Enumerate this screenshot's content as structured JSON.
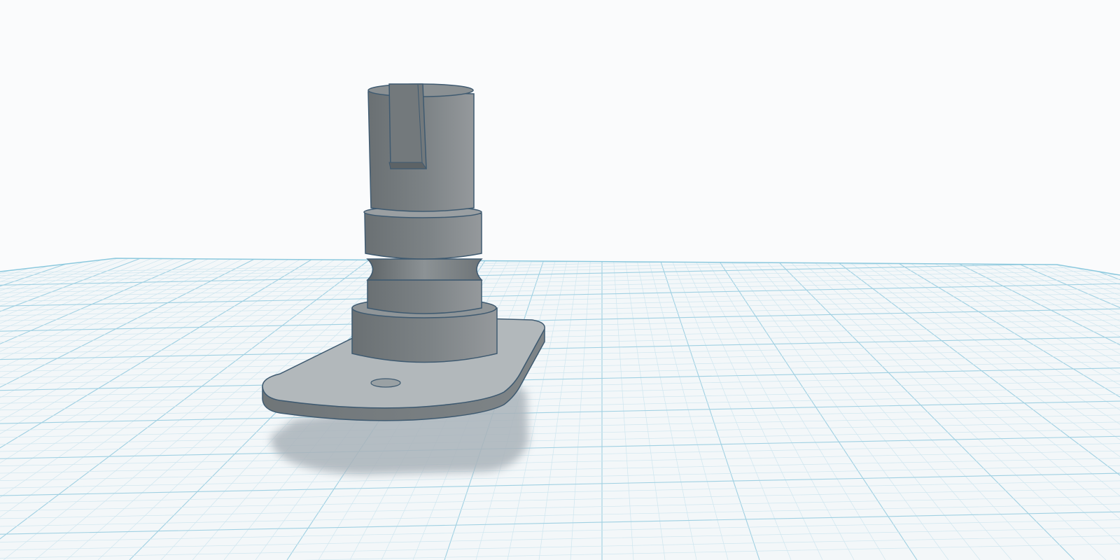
{
  "scene": {
    "type": "3d-design-workplane",
    "background_color": "#fafbfc",
    "workplane": {
      "fill_color": "#f3f7f9",
      "grid_minor_color": "#cfe6ef",
      "grid_major_color": "#9fd0e2",
      "edge_color": "#8cc9de"
    },
    "object": {
      "name": "",
      "body_color": "#7e8487",
      "base_plate_top_color": "#b2b8bb",
      "outline_color": "#3f5a70",
      "shadow_color": "#aab3ba"
    }
  }
}
